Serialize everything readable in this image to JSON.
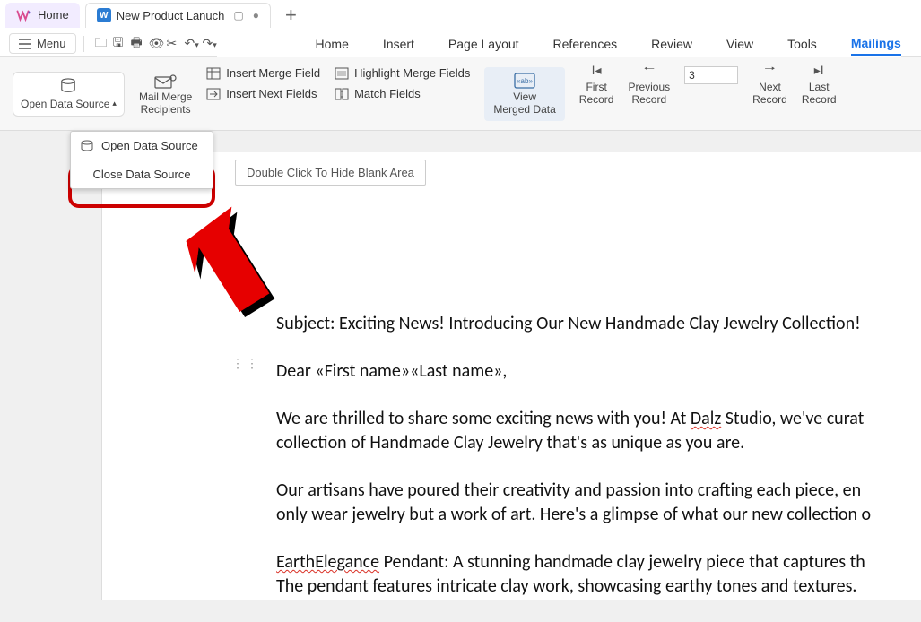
{
  "tabs": {
    "home": "Home",
    "doc": "New Product Lanuch"
  },
  "qat": {
    "menu": "Menu"
  },
  "menu_tabs": {
    "home": "Home",
    "insert": "Insert",
    "page_layout": "Page Layout",
    "references": "References",
    "review": "Review",
    "view": "View",
    "tools": "Tools",
    "mailings": "Mailings"
  },
  "ribbon": {
    "open_data_source": "Open Data Source",
    "mail_merge_recipients_l1": "Mail Merge",
    "mail_merge_recipients_l2": "Recipients",
    "insert_merge_field": "Insert Merge Field",
    "highlight_merge_fields": "Highlight Merge Fields",
    "insert_next_fields": "Insert Next Fields",
    "match_fields": "Match Fields",
    "view_l1": "View",
    "view_l2": "Merged Data",
    "first_l1": "First",
    "first_l2": "Record",
    "previous_l1": "Previous",
    "previous_l2": "Record",
    "record_value": "3",
    "next_l1": "Next",
    "next_l2": "Record",
    "last_l1": "Last",
    "last_l2": "Record"
  },
  "dropdown": {
    "open": "Open Data Source",
    "close": "Close Data Source"
  },
  "tooltip": "Double Click To Hide Blank Area",
  "document": {
    "subject": "Subject: Exciting News! Introducing Our New Handmade Clay Jewelry Collection!",
    "greeting_pre": "Dear ",
    "mf_first": "«First name»",
    "mf_last": "«Last name»",
    "greeting_post": ",",
    "p2a": "We are thrilled to share some exciting news with you! At ",
    "p2_dalz": "Dalz",
    "p2b": " Studio, we've curat",
    "p2c": "collection of Handmade Clay Jewelry that's as unique as you are.",
    "p3a": "Our artisans have poured their creativity and passion into crafting each piece, en",
    "p3b": "only wear jewelry but a work of art. Here's a glimpse of what our new collection o",
    "p4_ee": "EarthElegance",
    "p4a": " Pendant: A stunning handmade clay jewelry piece that captures th",
    "p4b": "The pendant features intricate clay work, showcasing earthy tones and textures."
  }
}
